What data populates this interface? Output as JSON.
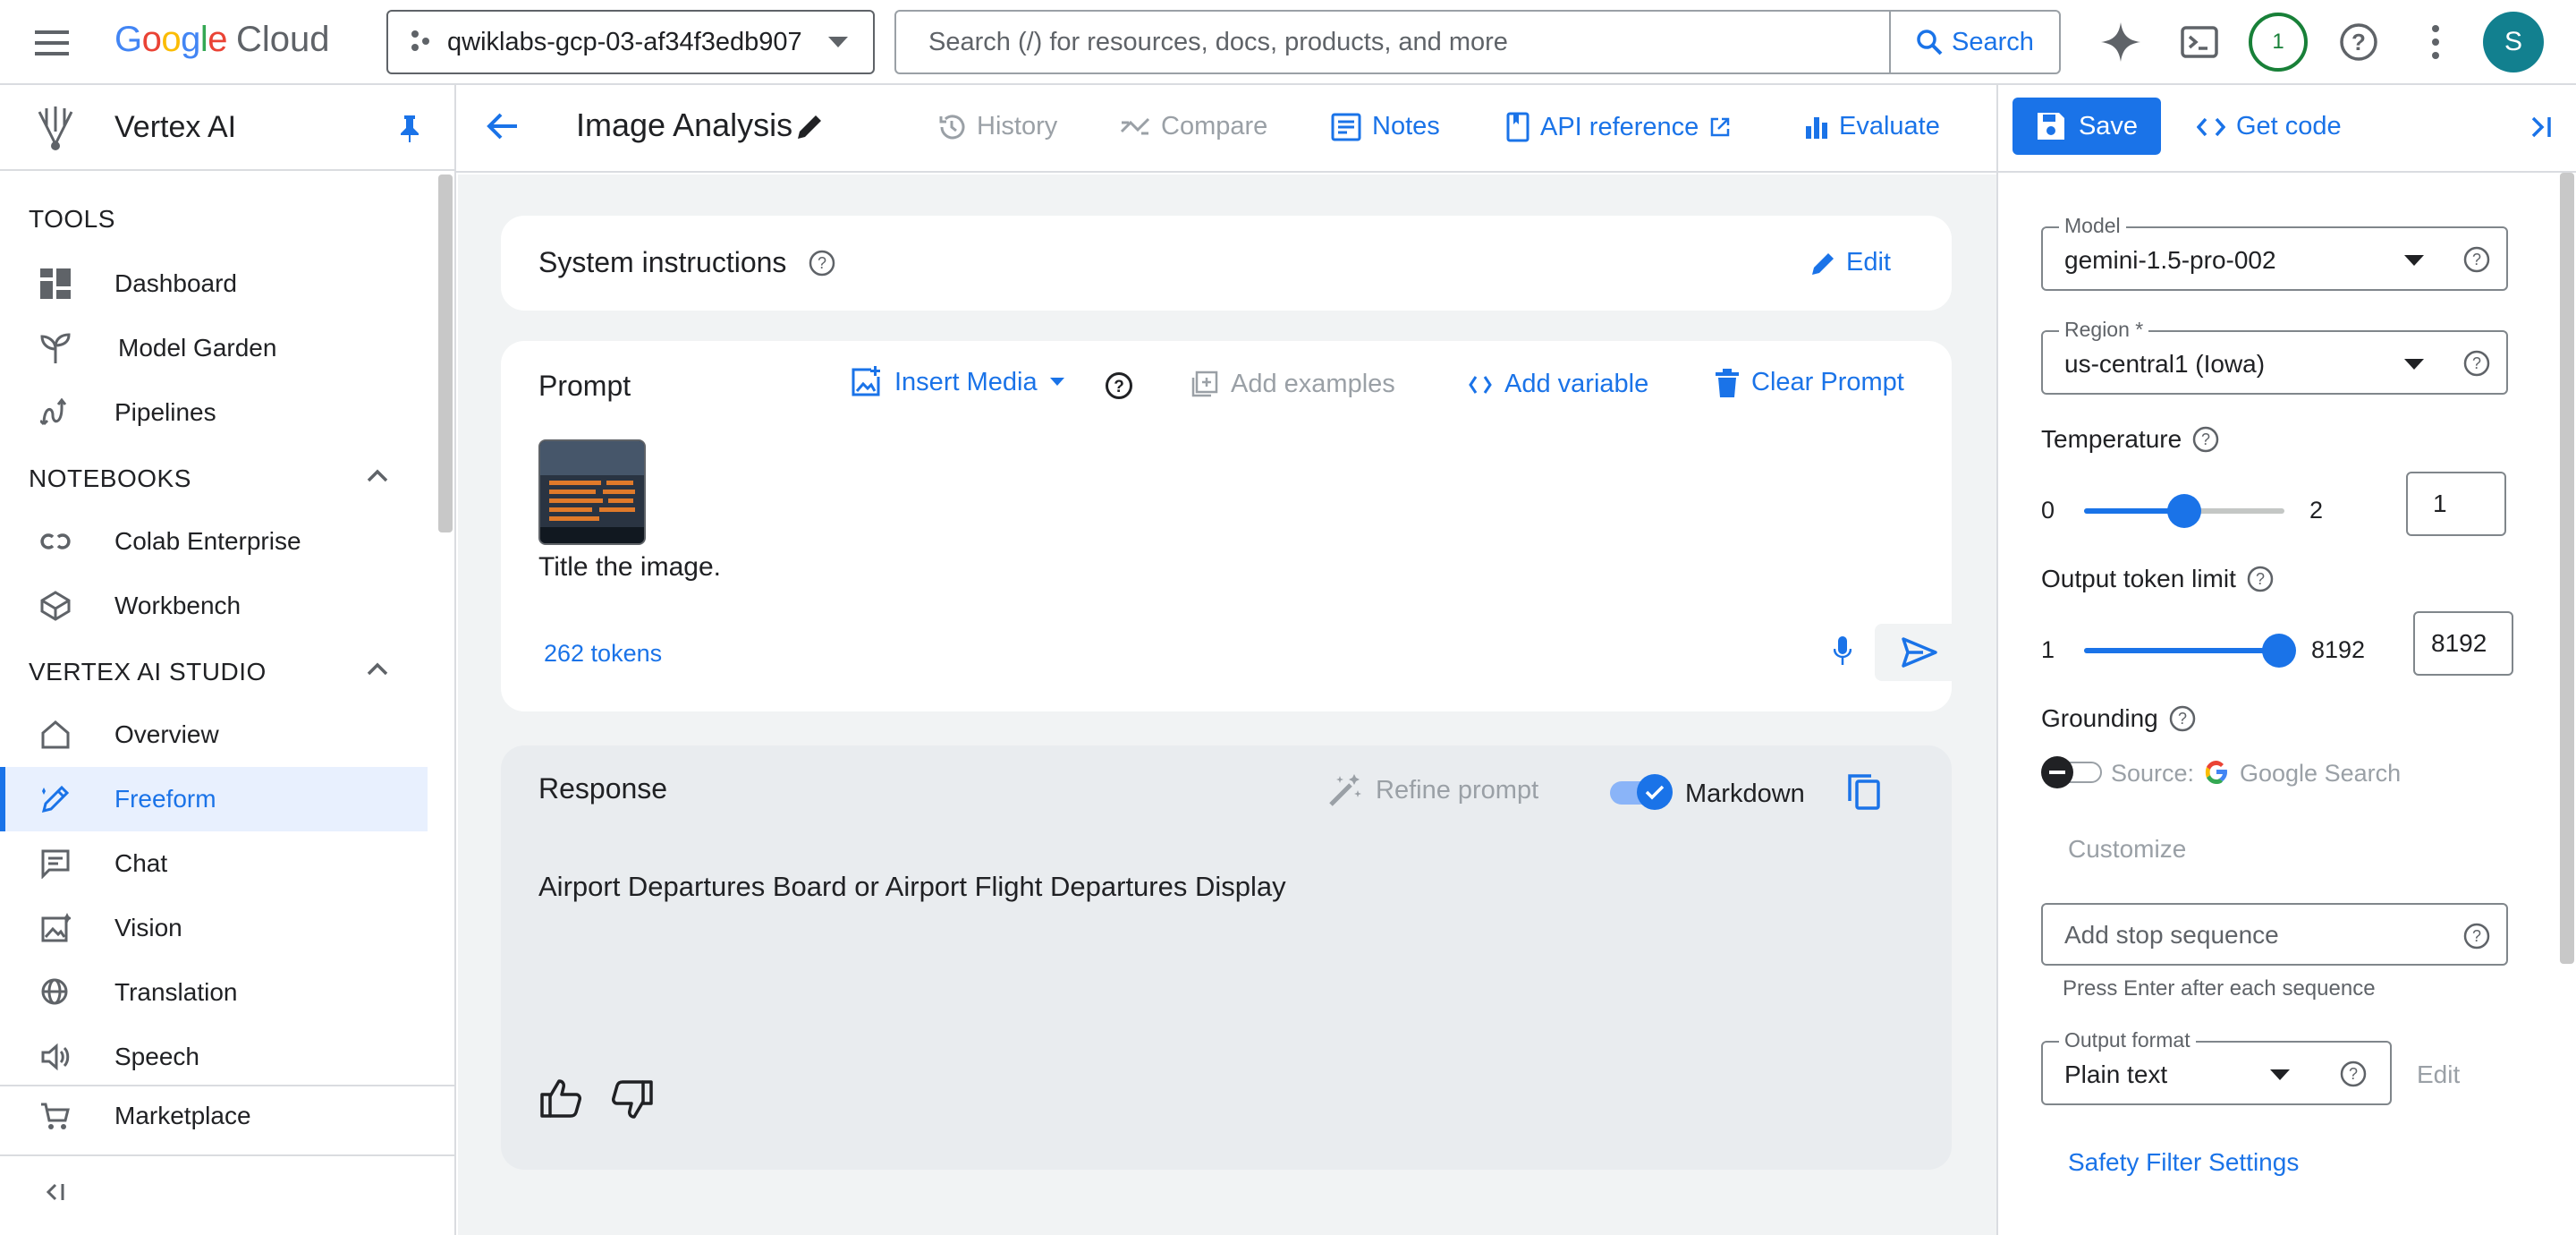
{
  "topbar": {
    "logo_google": "Google",
    "logo_cloud": "Cloud",
    "project": "qwiklabs-gcp-03-af34f3edb907",
    "search_placeholder": "Search (/) for resources, docs, products, and more",
    "search_button": "Search",
    "notifications_count": "1",
    "avatar_initial": "S"
  },
  "sidebar": {
    "product": "Vertex AI",
    "sections": {
      "tools": "TOOLS",
      "notebooks": "NOTEBOOKS",
      "studio": "VERTEX AI STUDIO"
    },
    "items": {
      "dashboard": "Dashboard",
      "model_garden": "Model Garden",
      "pipelines": "Pipelines",
      "colab": "Colab Enterprise",
      "workbench": "Workbench",
      "overview": "Overview",
      "freeform": "Freeform",
      "chat": "Chat",
      "vision": "Vision",
      "translation": "Translation",
      "speech": "Speech",
      "marketplace": "Marketplace"
    }
  },
  "toolbar": {
    "title": "Image Analysis",
    "history": "History",
    "compare": "Compare",
    "notes": "Notes",
    "api_reference": "API reference",
    "evaluate": "Evaluate",
    "save": "Save",
    "get_code": "Get code"
  },
  "system": {
    "title": "System instructions",
    "edit": "Edit"
  },
  "prompt": {
    "title": "Prompt",
    "insert_media": "Insert Media",
    "add_examples": "Add examples",
    "add_variable": "Add variable",
    "clear_prompt": "Clear Prompt",
    "text": "Title the image.",
    "tokens": "262 tokens"
  },
  "response": {
    "title": "Response",
    "refine_prompt": "Refine prompt",
    "markdown": "Markdown",
    "markdown_on": true,
    "text": "Airport Departures Board or Airport Flight Departures Display"
  },
  "settings": {
    "model_label": "Model",
    "model_value": "gemini-1.5-pro-002",
    "region_label": "Region *",
    "region_value": "us-central1 (Iowa)",
    "temperature_label": "Temperature",
    "temperature_min": "0",
    "temperature_max": "2",
    "temperature_value": "1",
    "temperature_fraction": 0.5,
    "token_label": "Output token limit",
    "token_min": "1",
    "token_max": "8192",
    "token_value": "8192",
    "token_fraction": 1.0,
    "grounding_label": "Grounding",
    "grounding_source_prefix": "Source:",
    "grounding_source": "Google Search",
    "customize": "Customize",
    "stop_sequence_placeholder": "Add stop sequence",
    "stop_sequence_hint": "Press Enter after each sequence",
    "output_format_label": "Output format",
    "output_format_value": "Plain text",
    "output_format_edit": "Edit",
    "safety": "Safety Filter Settings"
  },
  "colors": {
    "accent": "#1a73e8",
    "active_bg": "#e8f0fe",
    "page_bg": "#f1f3f4",
    "ai_green": "#188038"
  }
}
